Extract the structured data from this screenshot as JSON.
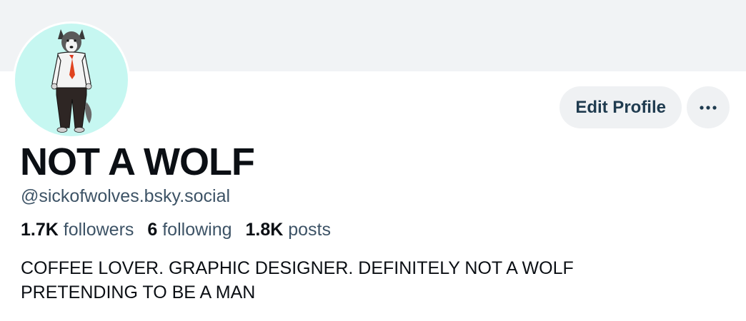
{
  "profile": {
    "display_name": "NOT A WOLF",
    "handle": "@sickofwolves.bsky.social",
    "bio_lines": [
      "COFFEE LOVER. GRAPHIC DESIGNER. DEFINITELY NOT A WOLF",
      "PRETENDING TO BE A MAN"
    ],
    "avatar_icon": "wolf-in-suit-avatar"
  },
  "stats": {
    "followers_count": "1.7K",
    "followers_label": "followers",
    "following_count": "6",
    "following_label": "following",
    "posts_count": "1.8K",
    "posts_label": "posts"
  },
  "actions": {
    "edit_label": "Edit Profile",
    "more_icon": "ellipsis-icon"
  },
  "colors": {
    "banner": "#f1f3f5",
    "avatar_bg": "#c6f7f1",
    "button_bg": "#eff1f3",
    "button_text": "#1f3b4f",
    "secondary_text": "#3d5366",
    "primary_text": "#0b0f14"
  }
}
